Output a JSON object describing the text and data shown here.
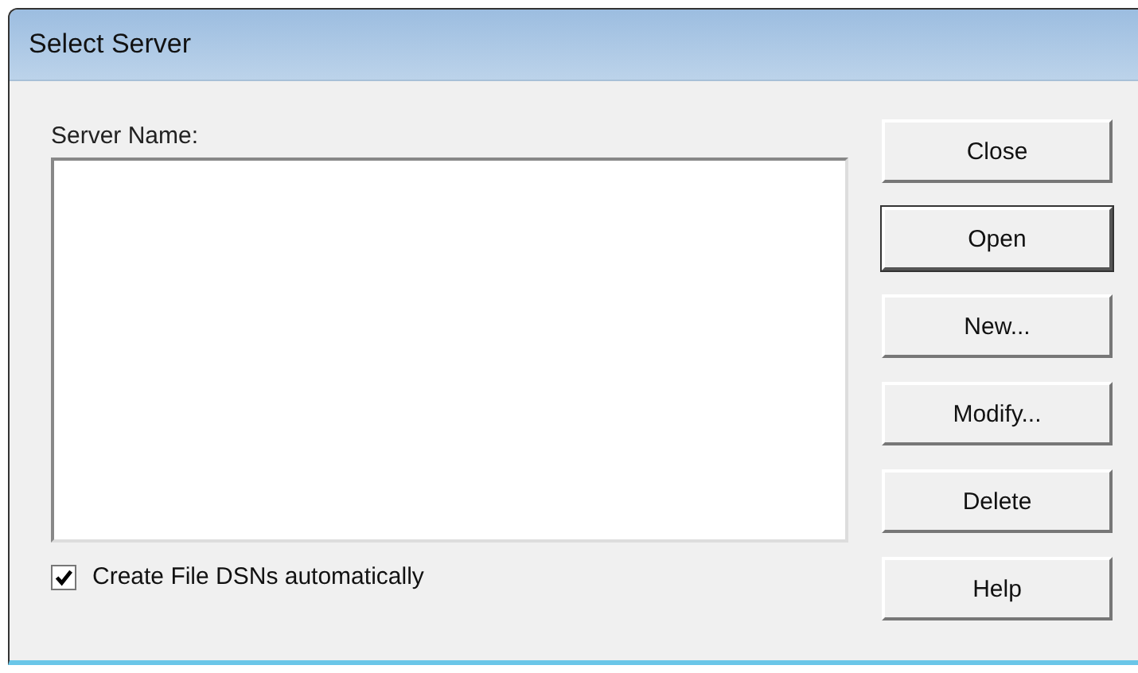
{
  "window": {
    "title": "Select Server"
  },
  "server_list": {
    "label": "Server Name:"
  },
  "buttons": [
    {
      "label": "Close",
      "default": false
    },
    {
      "label": "Open",
      "default": true
    },
    {
      "label": "New...",
      "default": false
    },
    {
      "label": "Modify...",
      "default": false
    },
    {
      "label": "Delete",
      "default": false
    },
    {
      "label": "Help",
      "default": false
    }
  ],
  "auto_dsn": {
    "label": "Create File DSNs automatically",
    "checked": true
  }
}
